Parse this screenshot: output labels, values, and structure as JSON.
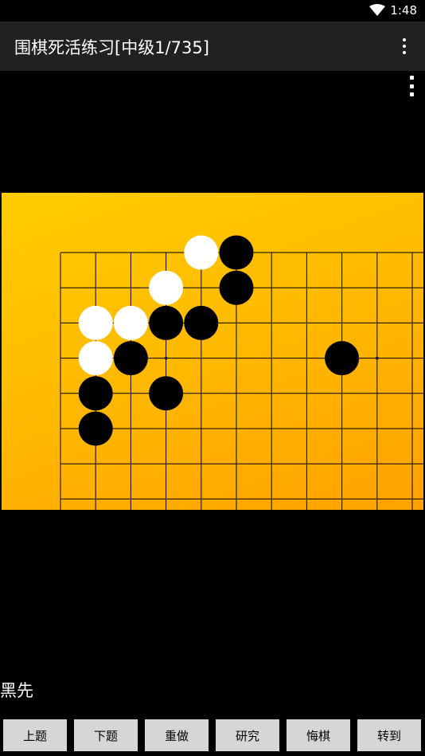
{
  "status_bar": {
    "time": "1:48",
    "icons": [
      "wifi-icon"
    ]
  },
  "app_bar": {
    "title": "围棋死活练习[中级1/735]",
    "menu_icon": "more-vert-icon"
  },
  "board": {
    "size": 19,
    "visible_columns": 11,
    "visible_rows": 9,
    "colors": {
      "wood_light": "#ffcc00",
      "wood_dark": "#ffa200",
      "line": "#000000",
      "black_stone": "#000000",
      "white_stone": "#ffffff"
    },
    "stones": [
      {
        "color": "white",
        "col": 4,
        "row": 0
      },
      {
        "color": "black",
        "col": 5,
        "row": 0
      },
      {
        "color": "white",
        "col": 3,
        "row": 1
      },
      {
        "color": "black",
        "col": 5,
        "row": 1
      },
      {
        "color": "white",
        "col": 1,
        "row": 2
      },
      {
        "color": "white",
        "col": 2,
        "row": 2
      },
      {
        "color": "black",
        "col": 3,
        "row": 2
      },
      {
        "color": "black",
        "col": 4,
        "row": 2
      },
      {
        "color": "white",
        "col": 1,
        "row": 3
      },
      {
        "color": "black",
        "col": 2,
        "row": 3
      },
      {
        "color": "black",
        "col": 8,
        "row": 3
      },
      {
        "color": "black",
        "col": 1,
        "row": 4
      },
      {
        "color": "black",
        "col": 3,
        "row": 4
      },
      {
        "color": "black",
        "col": 1,
        "row": 5
      }
    ],
    "star_points": [
      {
        "col": 3,
        "row": 3
      },
      {
        "col": 9,
        "row": 3
      }
    ]
  },
  "prompt": "黑先",
  "buttons": [
    {
      "id": "prev",
      "label": "上题"
    },
    {
      "id": "next",
      "label": "下题"
    },
    {
      "id": "redo",
      "label": "重做"
    },
    {
      "id": "study",
      "label": "研究"
    },
    {
      "id": "undo",
      "label": "悔棋"
    },
    {
      "id": "goto",
      "label": "转到"
    }
  ]
}
